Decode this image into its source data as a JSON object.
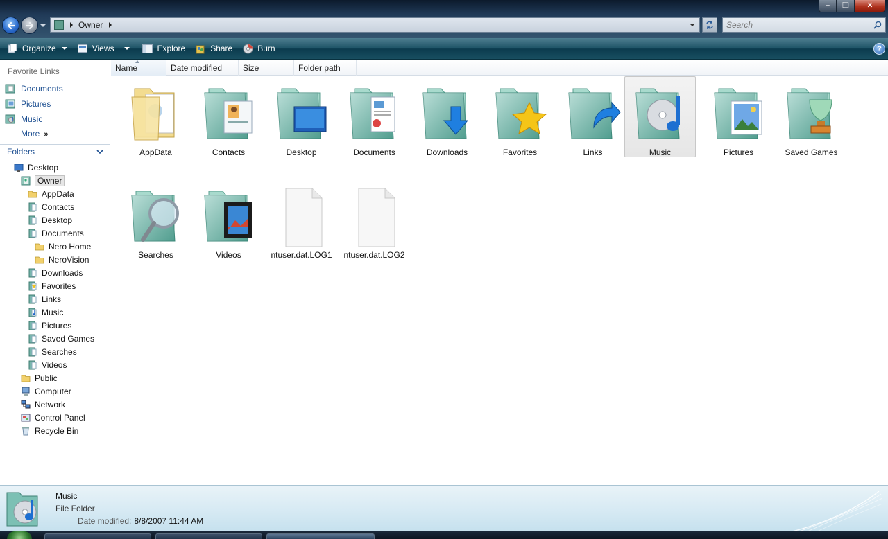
{
  "window": {
    "controls": {
      "minimize": "minimize-button",
      "maximize": "maximize-button",
      "close": "close-button"
    }
  },
  "address": {
    "crumbs": [
      "Owner"
    ],
    "search_placeholder": "Search"
  },
  "toolbar": {
    "organize": "Organize",
    "views": "Views",
    "explore": "Explore",
    "share": "Share",
    "burn": "Burn",
    "help": "?"
  },
  "nav": {
    "favorites_title": "Favorite Links",
    "favorites": [
      "Documents",
      "Pictures",
      "Music"
    ],
    "more": "More",
    "folders_title": "Folders",
    "tree": [
      {
        "label": "Desktop",
        "level": 0,
        "icon": "desktop-icon"
      },
      {
        "label": "Owner",
        "level": 1,
        "icon": "user-folder-icon",
        "selected": true
      },
      {
        "label": "AppData",
        "level": 2,
        "icon": "folder-icon"
      },
      {
        "label": "Contacts",
        "level": 2,
        "icon": "contacts-folder-icon"
      },
      {
        "label": "Desktop",
        "level": 2,
        "icon": "desktop-folder-icon"
      },
      {
        "label": "Documents",
        "level": 2,
        "icon": "documents-folder-icon"
      },
      {
        "label": "Nero Home",
        "level": 3,
        "icon": "folder-icon"
      },
      {
        "label": "NeroVision",
        "level": 3,
        "icon": "folder-icon"
      },
      {
        "label": "Downloads",
        "level": 2,
        "icon": "downloads-folder-icon"
      },
      {
        "label": "Favorites",
        "level": 2,
        "icon": "favorites-folder-icon"
      },
      {
        "label": "Links",
        "level": 2,
        "icon": "links-folder-icon"
      },
      {
        "label": "Music",
        "level": 2,
        "icon": "music-folder-icon"
      },
      {
        "label": "Pictures",
        "level": 2,
        "icon": "pictures-folder-icon"
      },
      {
        "label": "Saved Games",
        "level": 2,
        "icon": "saved-games-folder-icon"
      },
      {
        "label": "Searches",
        "level": 2,
        "icon": "searches-folder-icon"
      },
      {
        "label": "Videos",
        "level": 2,
        "icon": "videos-folder-icon"
      },
      {
        "label": "Public",
        "level": 1,
        "icon": "folder-icon"
      },
      {
        "label": "Computer",
        "level": 1,
        "icon": "computer-icon"
      },
      {
        "label": "Network",
        "level": 1,
        "icon": "network-icon"
      },
      {
        "label": "Control Panel",
        "level": 1,
        "icon": "control-panel-icon"
      },
      {
        "label": "Recycle Bin",
        "level": 1,
        "icon": "recycle-bin-icon"
      }
    ]
  },
  "columns": [
    "Name",
    "Date modified",
    "Size",
    "Folder path"
  ],
  "items": [
    {
      "label": "AppData",
      "kind": "plain-folder",
      "icon": "folder-icon"
    },
    {
      "label": "Contacts",
      "kind": "contacts",
      "icon": "contacts-folder-icon"
    },
    {
      "label": "Desktop",
      "kind": "desktop",
      "icon": "desktop-folder-icon"
    },
    {
      "label": "Documents",
      "kind": "documents",
      "icon": "documents-folder-icon"
    },
    {
      "label": "Downloads",
      "kind": "downloads",
      "icon": "downloads-folder-icon"
    },
    {
      "label": "Favorites",
      "kind": "favorites",
      "icon": "favorites-folder-icon"
    },
    {
      "label": "Links",
      "kind": "links",
      "icon": "links-folder-icon"
    },
    {
      "label": "Music",
      "kind": "music",
      "icon": "music-folder-icon",
      "selected": true
    },
    {
      "label": "Pictures",
      "kind": "pictures",
      "icon": "pictures-folder-icon"
    },
    {
      "label": "Saved Games",
      "kind": "games",
      "icon": "saved-games-folder-icon"
    },
    {
      "label": "Searches",
      "kind": "searches",
      "icon": "searches-folder-icon"
    },
    {
      "label": "Videos",
      "kind": "videos",
      "icon": "videos-folder-icon"
    },
    {
      "label": "ntuser.dat.LOG1",
      "kind": "file",
      "icon": "file-icon"
    },
    {
      "label": "ntuser.dat.LOG2",
      "kind": "file",
      "icon": "file-icon"
    }
  ],
  "details": {
    "name": "Music",
    "type": "File Folder",
    "modified_label": "Date modified:",
    "modified_value": "8/8/2007 11:44 AM"
  },
  "colors": {
    "link": "#1d4f91",
    "folder_teal": "#5fb0a8",
    "toolbar": "#1f5467"
  }
}
